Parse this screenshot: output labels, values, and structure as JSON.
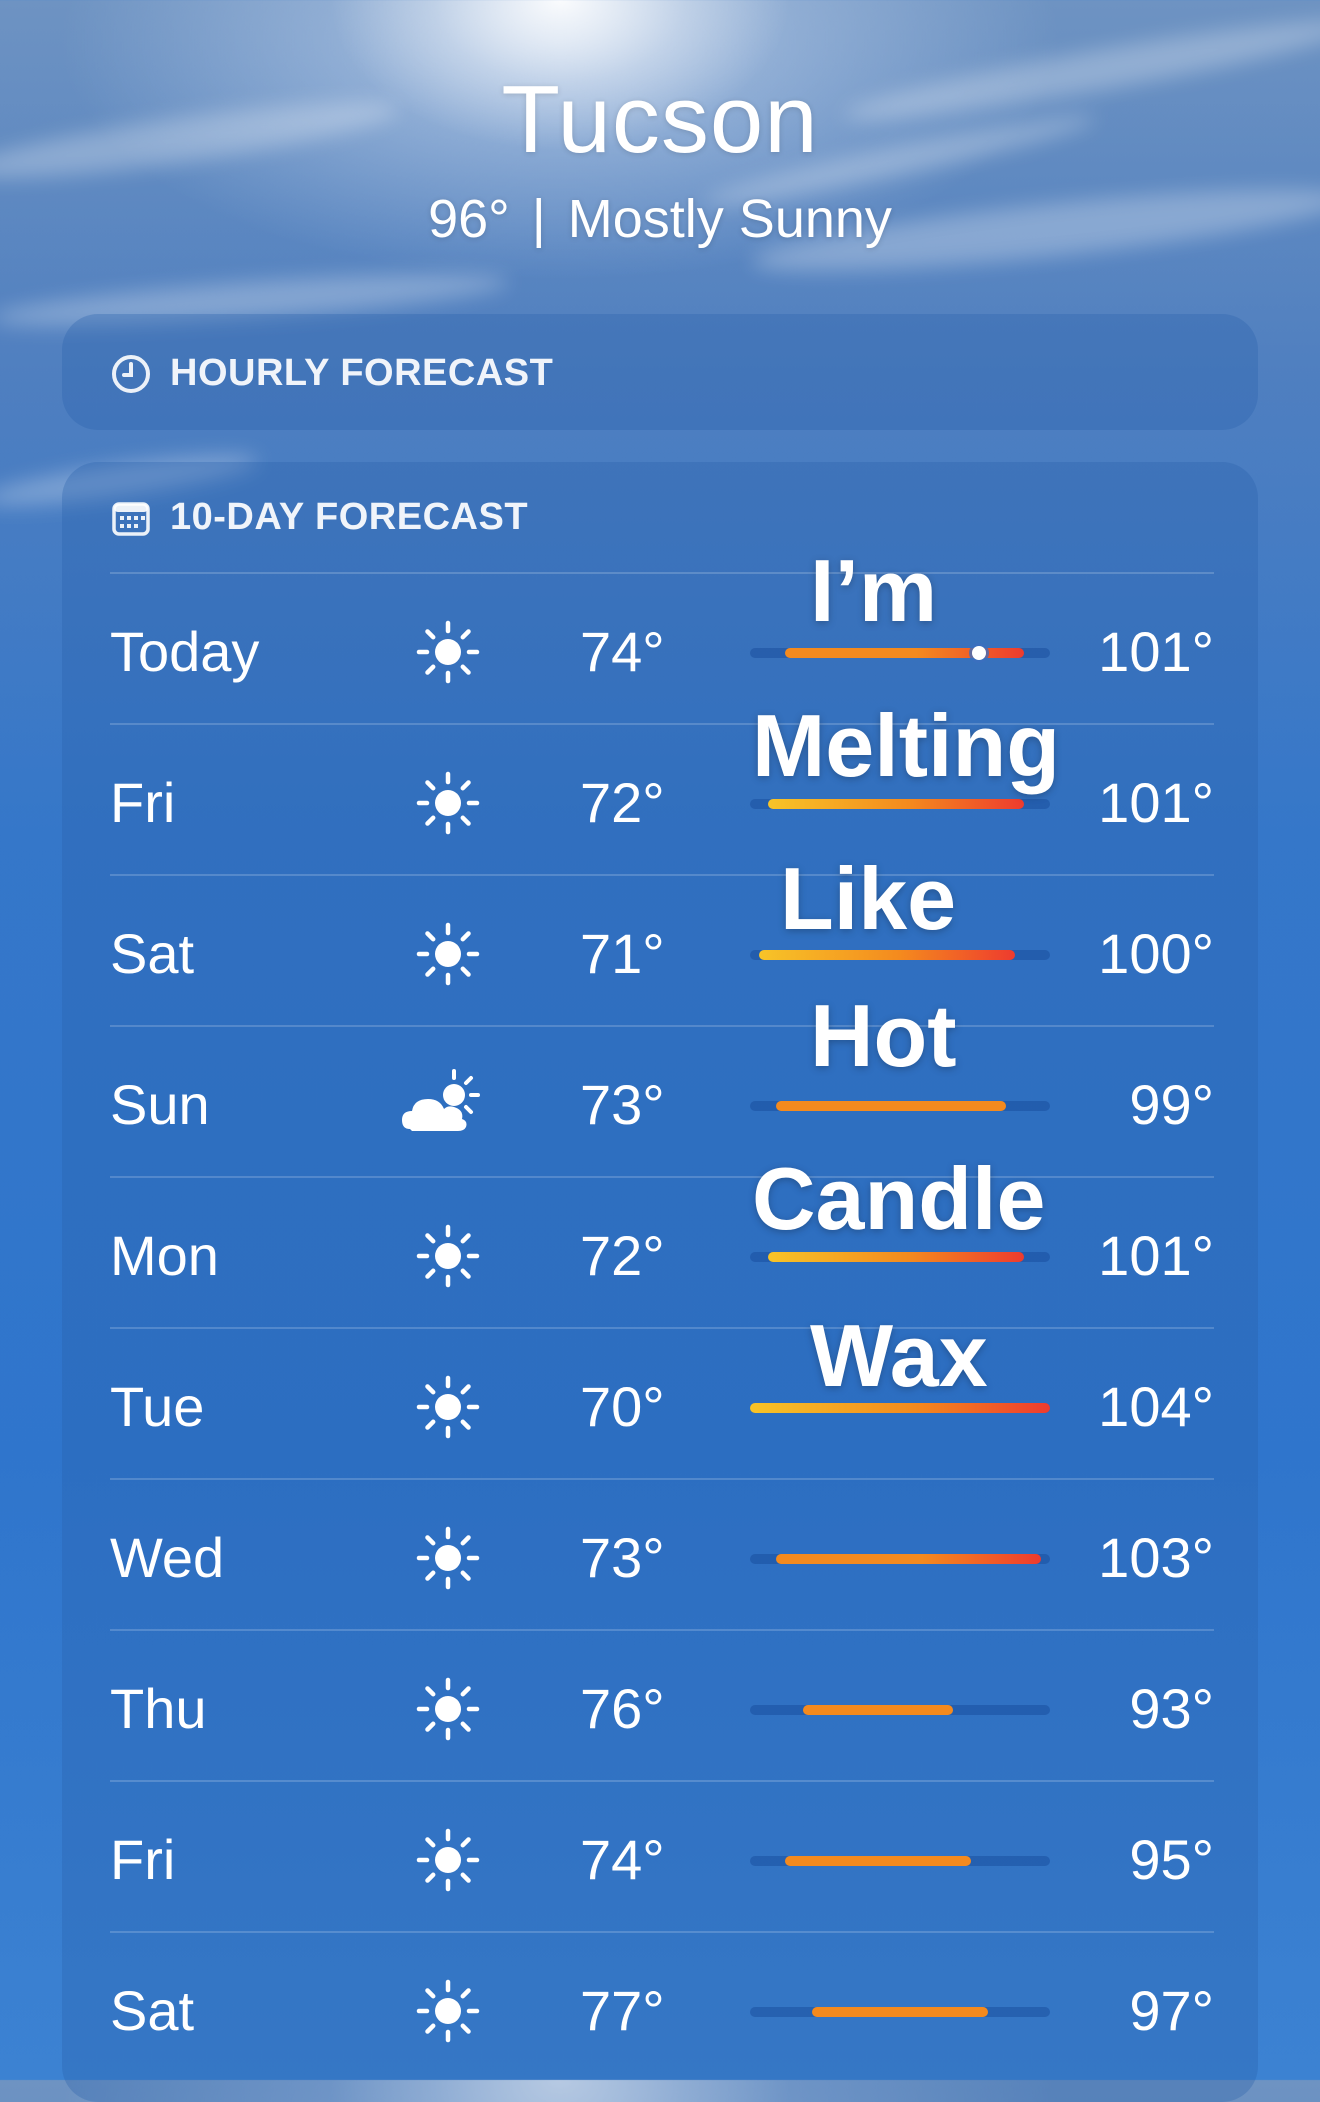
{
  "location": {
    "city": "Tucson",
    "temp": "96°",
    "separator": "|",
    "condition": "Mostly Sunny"
  },
  "hourly": {
    "title": "HOURLY FORECAST",
    "icon": "clock-icon"
  },
  "ten_day": {
    "title": "10-DAY FORECAST",
    "icon": "calendar-icon",
    "days": [
      {
        "day": "Today",
        "icon": "sun-icon",
        "low": "74°",
        "high": "101°",
        "current_temp_marker": true
      },
      {
        "day": "Fri",
        "icon": "sun-icon",
        "low": "72°",
        "high": "101°"
      },
      {
        "day": "Sat",
        "icon": "sun-icon",
        "low": "71°",
        "high": "100°"
      },
      {
        "day": "Sun",
        "icon": "partly-cloudy-icon",
        "low": "73°",
        "high": "99°"
      },
      {
        "day": "Mon",
        "icon": "sun-icon",
        "low": "72°",
        "high": "101°"
      },
      {
        "day": "Tue",
        "icon": "sun-icon",
        "low": "70°",
        "high": "104°"
      },
      {
        "day": "Wed",
        "icon": "sun-icon",
        "low": "73°",
        "high": "103°"
      },
      {
        "day": "Thu",
        "icon": "sun-icon",
        "low": "76°",
        "high": "93°"
      },
      {
        "day": "Fri",
        "icon": "sun-icon",
        "low": "74°",
        "high": "95°"
      },
      {
        "day": "Sat",
        "icon": "sun-icon",
        "low": "77°",
        "high": "97°"
      }
    ],
    "range_bar_scale": {
      "min": 70,
      "max": 104,
      "current": 96
    }
  },
  "meme_overlay": [
    "I’m",
    "Melting",
    "Like",
    "Hot",
    "Candle",
    "Wax"
  ],
  "colors": {
    "bar_cool": "#f7c428",
    "bar_warm": "#f48a1e",
    "bar_hot": "#ee3b2e"
  }
}
